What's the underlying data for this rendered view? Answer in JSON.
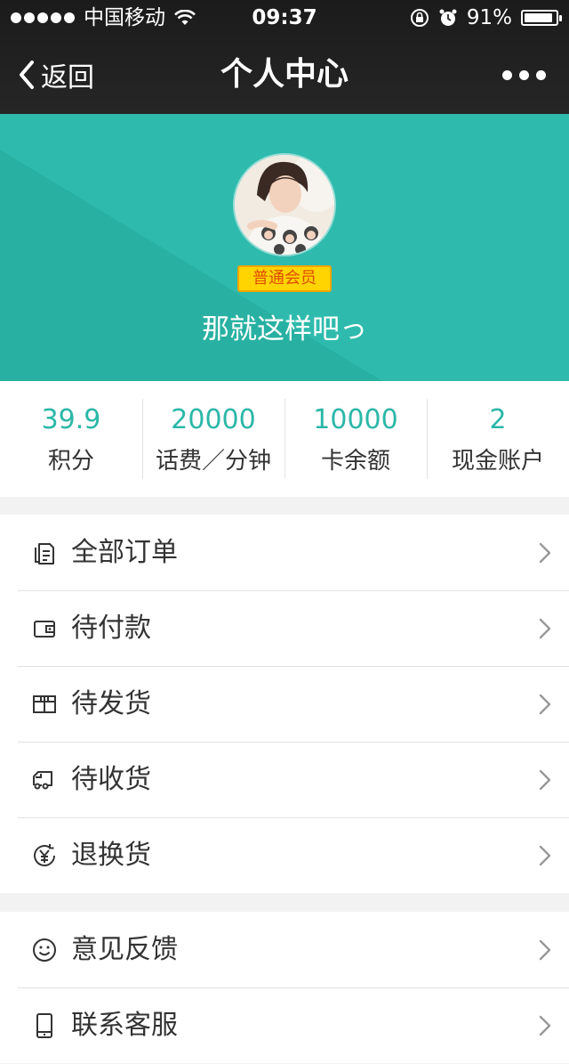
{
  "status_bar": {
    "carrier": "中国移动",
    "time": "09:37",
    "battery_percent": "91%",
    "battery_level": 0.91,
    "icons": [
      "signal-dots-icon",
      "wifi-icon",
      "rotation-lock-icon",
      "alarm-icon",
      "battery-icon"
    ]
  },
  "nav": {
    "back_label": "返回",
    "title": "个人中心",
    "more_icon": "more-dots-icon"
  },
  "profile": {
    "member_level": "普通会员",
    "nickname": "那就这样吧っ",
    "accent_color": "#2bb7a8",
    "badge_color": "#ffd400"
  },
  "stats": [
    {
      "value": "39.9",
      "label": "积分"
    },
    {
      "value": "20000",
      "label": "话费／分钟"
    },
    {
      "value": "10000",
      "label": "卡余额"
    },
    {
      "value": "2",
      "label": "现金账户"
    }
  ],
  "menu_orders": [
    {
      "label": "全部订单",
      "icon": "orders-icon"
    },
    {
      "label": "待付款",
      "icon": "wallet-icon"
    },
    {
      "label": "待发货",
      "icon": "package-icon"
    },
    {
      "label": "待收货",
      "icon": "truck-icon"
    },
    {
      "label": "退换货",
      "icon": "refund-icon"
    }
  ],
  "menu_service": [
    {
      "label": "意见反馈",
      "icon": "smiley-icon"
    },
    {
      "label": "联系客服",
      "icon": "phone-icon"
    }
  ]
}
